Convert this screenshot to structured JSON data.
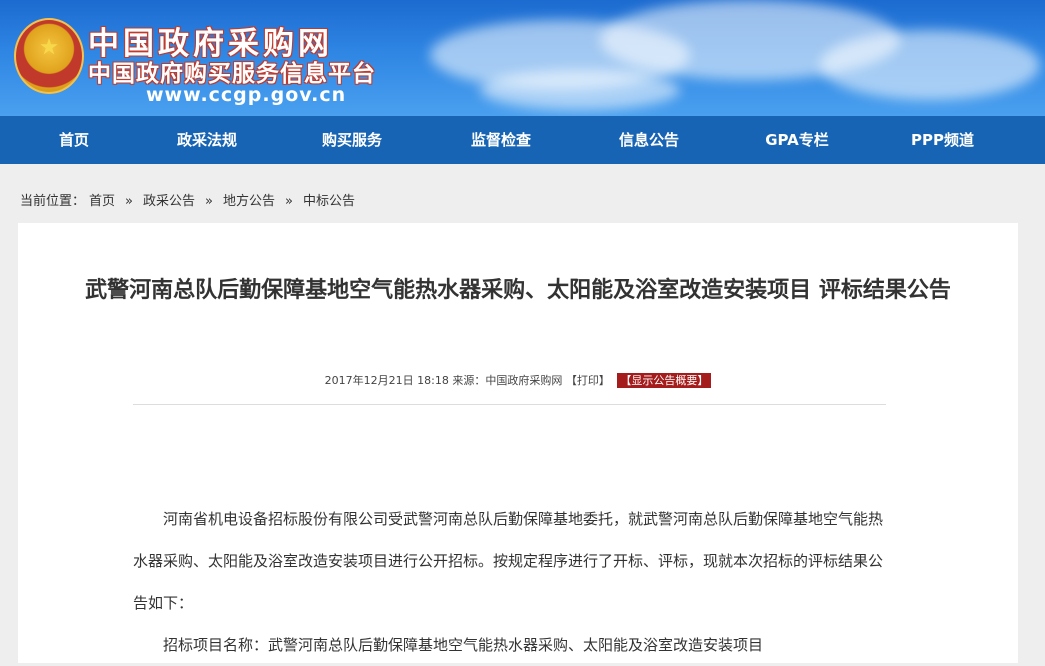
{
  "header": {
    "site_name": "中国政府采购网",
    "site_subname": "中国政府购买服务信息平台",
    "site_url": "www.ccgp.gov.cn"
  },
  "nav": {
    "items": [
      {
        "label": "首页"
      },
      {
        "label": "政采法规"
      },
      {
        "label": "购买服务"
      },
      {
        "label": "监督检查"
      },
      {
        "label": "信息公告"
      },
      {
        "label": "GPA专栏"
      },
      {
        "label": "PPP频道"
      }
    ]
  },
  "breadcrumb": {
    "prefix": "当前位置：",
    "items": [
      "首页",
      "政采公告",
      "地方公告",
      "中标公告"
    ],
    "separator": "»"
  },
  "article": {
    "title": "武警河南总队后勤保障基地空气能热水器采购、太阳能及浴室改造安装项目 评标结果公告",
    "date": "2017年12月21日",
    "time": "18:18",
    "source_label": "来源：",
    "source": "中国政府采购网",
    "print_label": "【打印】",
    "summary_label": "【显示公告概要】",
    "paragraph1": "河南省机电设备招标股份有限公司受武警河南总队后勤保障基地委托，就武警河南总队后勤保障基地空气能热水器采购、太阳能及浴室改造安装项目进行公开招标。按规定程序进行了开标、评标，现就本次招标的评标结果公告如下：",
    "paragraph2": "招标项目名称：武警河南总队后勤保障基地空气能热水器采购、太阳能及浴室改造安装项目"
  },
  "colors": {
    "nav_bg": "#1664b3",
    "banner": "#2f86e3",
    "badge": "#a51c1c"
  }
}
